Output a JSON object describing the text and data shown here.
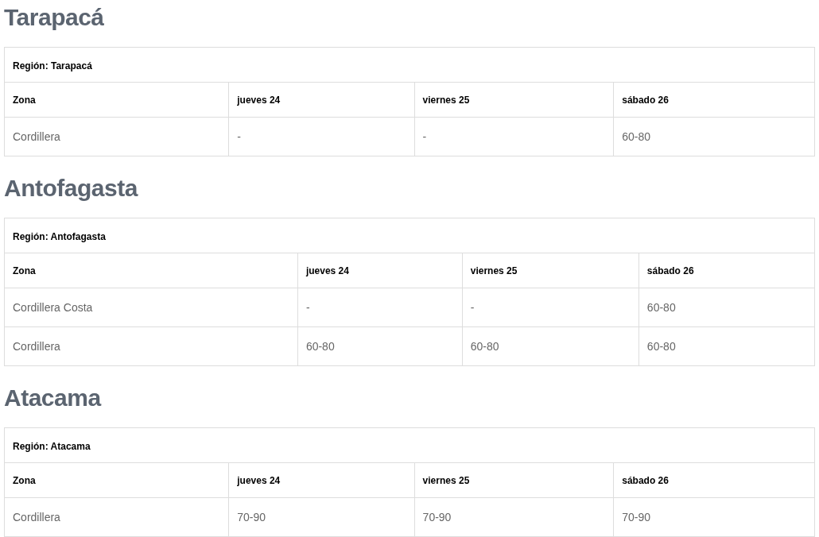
{
  "sections": [
    {
      "title": "Tarapacá",
      "caption": "Región: Tarapacá",
      "columns": [
        "Zona",
        "jueves 24",
        "viernes 25",
        "sábado 26"
      ],
      "rows": [
        [
          "Cordillera",
          "-",
          "-",
          "60-80"
        ]
      ]
    },
    {
      "title": "Antofagasta",
      "caption": "Región: Antofagasta",
      "columns": [
        "Zona",
        "jueves 24",
        "viernes 25",
        "sábado 26"
      ],
      "rows": [
        [
          "Cordillera Costa",
          "-",
          "-",
          "60-80"
        ],
        [
          "Cordillera",
          "60-80",
          "60-80",
          "60-80"
        ]
      ]
    },
    {
      "title": "Atacama",
      "caption": "Región: Atacama",
      "columns": [
        "Zona",
        "jueves 24",
        "viernes 25",
        "sábado 26"
      ],
      "rows": [
        [
          "Cordillera",
          "70-90",
          "70-90",
          "70-90"
        ]
      ]
    }
  ]
}
